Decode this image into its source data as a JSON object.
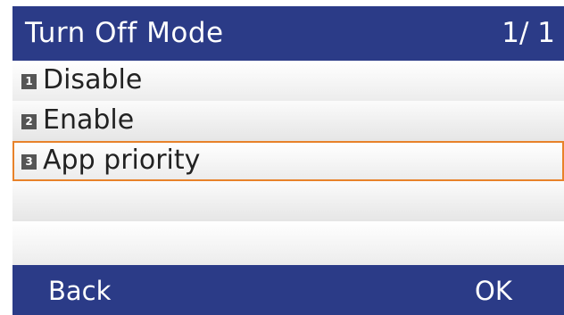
{
  "header": {
    "title": "Turn Off Mode",
    "page": "1/ 1"
  },
  "menu": {
    "items": [
      {
        "number": "1",
        "label": "Disable"
      },
      {
        "number": "2",
        "label": "Enable"
      },
      {
        "number": "3",
        "label": "App priority"
      }
    ],
    "selected_index": 2
  },
  "softkeys": {
    "back": "Back",
    "ok": "OK"
  },
  "colors": {
    "bar_background": "#2b3b87",
    "selection_border": "#e8822a",
    "badge_background": "#555555"
  }
}
